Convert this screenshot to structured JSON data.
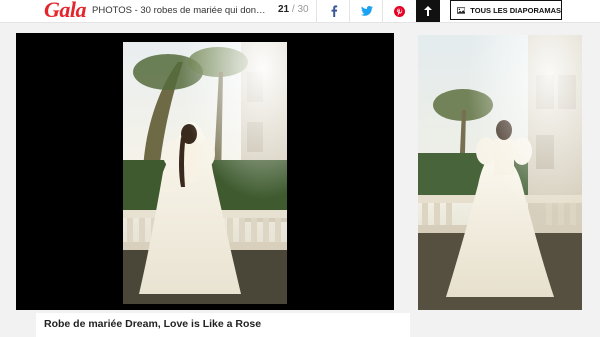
{
  "header": {
    "logo": "Gala",
    "title": "PHOTOS - 30 robes de mariée qui donnent e...",
    "counter_current": "21",
    "counter_separator": "/",
    "counter_total": "30",
    "all_slideshows_label": "TOUS LES DIAPORAMAS"
  },
  "share": {
    "facebook_icon": "facebook-icon",
    "twitter_icon": "twitter-icon",
    "pinterest_icon": "pinterest-icon",
    "facebook_color": "#3b5998",
    "twitter_color": "#1da1f2",
    "pinterest_color": "#e60023"
  },
  "slides": {
    "current_caption": "Robe de mariée Dream, Love is Like a Rose"
  },
  "colors": {
    "brand": "#e3262c"
  }
}
